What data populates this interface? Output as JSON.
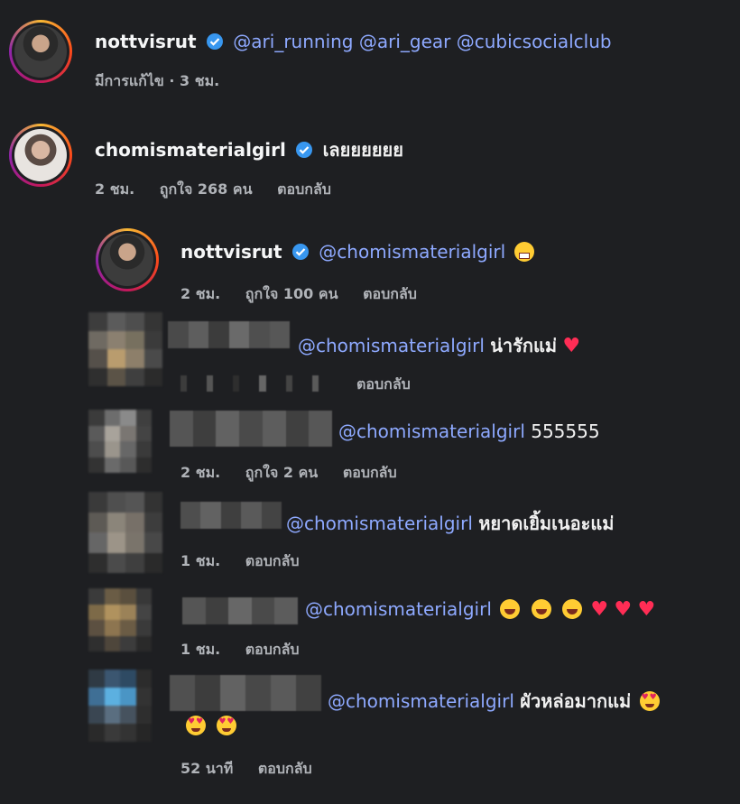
{
  "comments": [
    {
      "username": "nottvisrut",
      "body_mentions": "@ari_running @ari_gear @cubicsocialclub",
      "meta": {
        "edited": "มีการแก้ไข · 3 ชม."
      }
    },
    {
      "username": "chomismaterialgirl",
      "body_text": "เลยยยยยย",
      "meta": {
        "time": "2 ชม.",
        "likes": "ถูกใจ 268 คน",
        "reply": "ตอบกลับ"
      }
    }
  ],
  "replies": [
    {
      "username": "nottvisrut",
      "mention": "@chomismaterialgirl",
      "emoji": "grimace",
      "meta": {
        "time": "2 ชม.",
        "likes": "ถูกใจ 100 คน",
        "reply": "ตอบกลับ"
      }
    },
    {
      "mention": "@chomismaterialgirl",
      "text": "น่ารักแม่",
      "meta": {
        "reply": "ตอบกลับ"
      }
    },
    {
      "mention": "@chomismaterialgirl",
      "text": "555555",
      "meta": {
        "time": "2 ชม.",
        "likes": "ถูกใจ 2 คน",
        "reply": "ตอบกลับ"
      }
    },
    {
      "mention": "@chomismaterialgirl",
      "text": "หยาดเยิ้มเนอะแม่",
      "meta": {
        "time": "1 ชม.",
        "reply": "ตอบกลับ"
      }
    },
    {
      "mention": "@chomismaterialgirl",
      "meta": {
        "time": "1 ชม.",
        "reply": "ตอบกลับ"
      }
    },
    {
      "mention": "@chomismaterialgirl",
      "text": "ผัวหล่อมากแม่",
      "meta": {
        "time": "52 นาที",
        "reply": "ตอบกลับ"
      }
    }
  ],
  "colors": {
    "background": "#1e1f22",
    "mention": "#8ea9ff",
    "verified": "#3897f0",
    "meta": "#b0b3b8"
  }
}
